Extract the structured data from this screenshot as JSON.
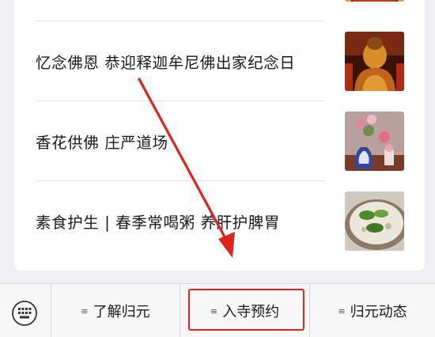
{
  "articles": [
    {
      "title": "",
      "thumb_icon": "temple-interior-thumbnail"
    },
    {
      "title": "忆念佛恩  恭迎释迦牟尼佛出家纪念日",
      "thumb_icon": "golden-buddha-statue-thumbnail"
    },
    {
      "title": "香花供佛  庄严道场",
      "thumb_icon": "flower-offering-vase-thumbnail"
    },
    {
      "title": "素食护生 | 春季常喝粥  养肝护脾胃",
      "thumb_icon": "vegetable-porridge-bowl-thumbnail"
    }
  ],
  "menu": {
    "keyboard_icon": "keyboard-icon",
    "items": [
      {
        "label": "了解归元",
        "icon": "menu-lines-icon"
      },
      {
        "label": "入寺预约",
        "icon": "menu-lines-icon"
      },
      {
        "label": "归元动态",
        "icon": "menu-lines-icon"
      }
    ],
    "highlight_color": "#e0241b"
  }
}
